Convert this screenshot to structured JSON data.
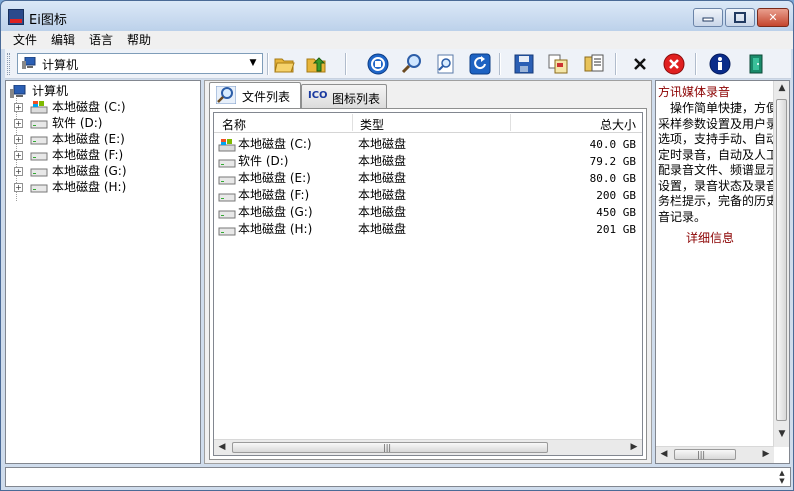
{
  "window": {
    "title": "Ei图标",
    "app_icon_text": "ICO"
  },
  "caption": {
    "minimize": "▭",
    "maximize": "□",
    "close": "✕"
  },
  "menu": [
    "文件",
    "编辑",
    "语言",
    "帮助"
  ],
  "address": {
    "value": "计算机"
  },
  "toolbar": {
    "buttons": [
      "open-folder",
      "up-folder",
      "stop",
      "search",
      "find",
      "refresh",
      "save",
      "export",
      "extract",
      "delete",
      "remove",
      "about",
      "exit"
    ]
  },
  "tree": {
    "root": "计算机",
    "drives": [
      "本地磁盘 (C:)",
      "软件 (D:)",
      "本地磁盘 (E:)",
      "本地磁盘 (F:)",
      "本地磁盘 (G:)",
      "本地磁盘 (H:)"
    ]
  },
  "tabs": [
    {
      "label": "文件列表",
      "icon": "magnifier-icon"
    },
    {
      "label": "图标列表",
      "icon": "ico-icon",
      "icon_text": "ICO"
    }
  ],
  "list": {
    "headers": {
      "name": "名称",
      "type": "类型",
      "size": "总大小"
    },
    "rows": [
      {
        "name": "本地磁盘 (C:)",
        "type": "本地磁盘",
        "size": "40.0 GB"
      },
      {
        "name": "软件 (D:)",
        "type": "本地磁盘",
        "size": "79.2 GB"
      },
      {
        "name": "本地磁盘 (E:)",
        "type": "本地磁盘",
        "size": "80.0 GB"
      },
      {
        "name": "本地磁盘 (F:)",
        "type": "本地磁盘",
        "size": "200 GB"
      },
      {
        "name": "本地磁盘 (G:)",
        "type": "本地磁盘",
        "size": "450 GB"
      },
      {
        "name": "本地磁盘 (H:)",
        "type": "本地磁盘",
        "size": "201 GB"
      }
    ]
  },
  "info": {
    "title": "方讯媒体录音",
    "lines": [
      "　操作简单快捷，方便",
      "采样参数设置及用户录",
      "选项，支持手动、自动",
      "定时录音，自动及人工",
      "配录音文件、频谱显示",
      "设置，录音状态及录音",
      "务栏提示，完备的历史",
      "音记录。"
    ],
    "link": "详细信息"
  },
  "scroll": {
    "left": "◀",
    "right": "▶",
    "up": "▲",
    "down": "▼",
    "grip": "|||"
  },
  "colors": {
    "accent_red": "#8b0000",
    "title_gradient_top": "#dbe8f7"
  }
}
